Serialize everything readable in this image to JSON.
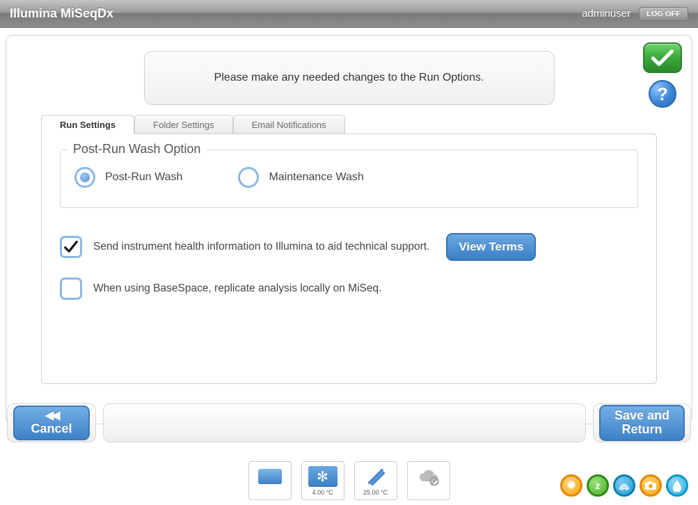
{
  "header": {
    "title": "Illumina MiSeqDx",
    "user": "adminuser",
    "logoff": "LOG OFF"
  },
  "instruction": "Please make any needed changes to the Run Options.",
  "tabs": [
    {
      "label": "Run Settings",
      "active": true
    },
    {
      "label": "Folder Settings",
      "active": false
    },
    {
      "label": "Email Notifications",
      "active": false
    }
  ],
  "wash": {
    "legend": "Post-Run Wash Option",
    "options": {
      "postrun": "Post-Run Wash",
      "maintenance": "Maintenance Wash"
    },
    "selected": "postrun"
  },
  "checks": {
    "health": {
      "text": "Send instrument health information to Illumina to aid technical support.",
      "checked": true
    },
    "basespace": {
      "text": "When using BaseSpace, replicate analysis locally on MiSeq.",
      "checked": false
    }
  },
  "buttons": {
    "view_terms": "View Terms",
    "cancel": "Cancel",
    "save_return_l1": "Save and",
    "save_return_l2": "Return"
  },
  "status": {
    "chiller_temp": "4.00 °C",
    "flowcell_temp": "25.00 °C"
  }
}
